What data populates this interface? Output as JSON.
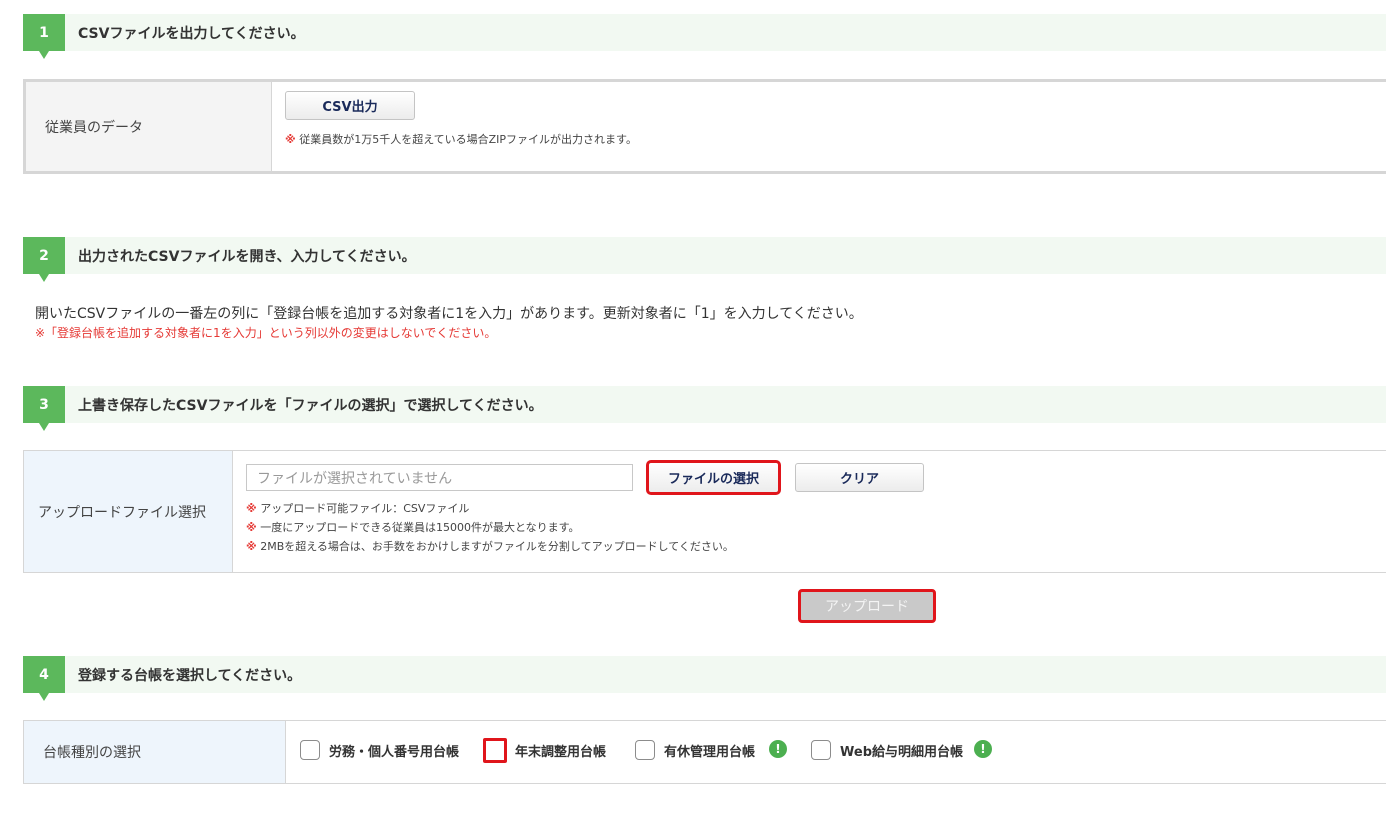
{
  "step1": {
    "number": "1",
    "title": "CSVファイルを出力してください。",
    "row_label": "従業員のデータ",
    "button_label": "CSV出力",
    "note_mark": "※",
    "note_text": "従業員数が1万5千人を超えている場合ZIPファイルが出力されます。"
  },
  "step2": {
    "number": "2",
    "title": "出力されたCSVファイルを開き、入力してください。",
    "instruction": "開いたCSVファイルの一番左の列に「登録台帳を追加する対象者に1を入力」があります。更新対象者に「1」を入力してください。",
    "warning": "※「登録台帳を追加する対象者に1を入力」という列以外の変更はしないでください。"
  },
  "step3": {
    "number": "3",
    "title": "上書き保存したCSVファイルを「ファイルの選択」で選択してください。",
    "row_label": "アップロードファイル選択",
    "file_placeholder": "ファイルが選択されていません",
    "choose_button": "ファイルの選択",
    "clear_button": "クリア",
    "notes": [
      {
        "mark": "※",
        "text": "アップロード可能ファイル：CSVファイル"
      },
      {
        "mark": "※",
        "text": "一度にアップロードできる従業員は15000件が最大となります。"
      },
      {
        "mark": "※",
        "text": "2MBを超える場合は、お手数をおかけしますがファイルを分割してアップロードしてください。"
      }
    ],
    "upload_button": "アップロード"
  },
  "step4": {
    "number": "4",
    "title": "登録する台帳を選択してください。",
    "row_label": "台帳種別の選択",
    "options": [
      {
        "label": "労務・個人番号用台帳",
        "checked": false
      },
      {
        "label": "年末調整用台帳",
        "checked": false
      },
      {
        "label": "有休管理用台帳",
        "checked": false,
        "info_icon": "!"
      },
      {
        "label": "Web給与明細用台帳",
        "checked": false,
        "info_icon": "!"
      }
    ]
  },
  "colors": {
    "accent_green": "#5cb85c",
    "header_bg": "#f2f9f2",
    "label_bg_gray": "#f4f4f4",
    "label_bg_blue": "#eef5fc",
    "warning_red": "#e53935",
    "highlight_red": "#e0151b"
  }
}
